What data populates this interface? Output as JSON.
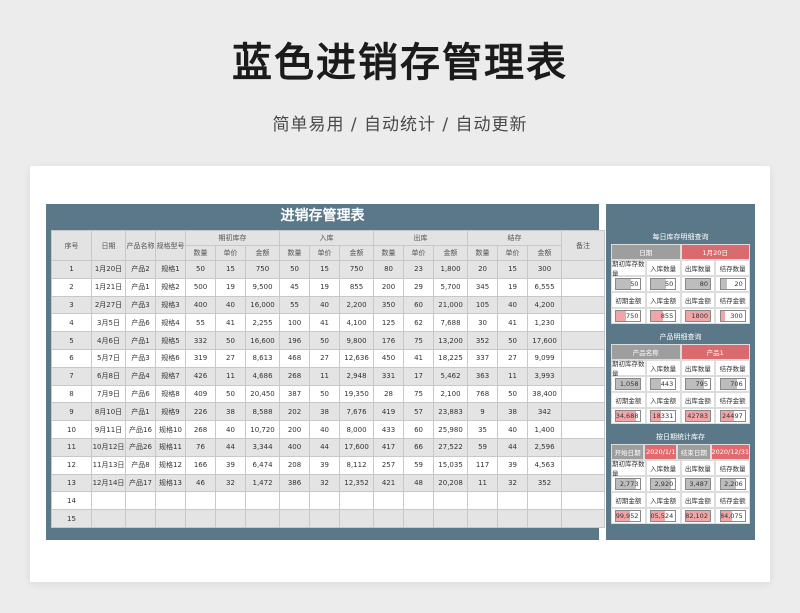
{
  "hero": {
    "title": "蓝色进销存管理表",
    "subtitle": "简单易用 / 自动统计 / 自动更新"
  },
  "sheet": {
    "title": "进销存管理表",
    "header_groups": {
      "seq": "序号",
      "date": "日期",
      "product": "产品名称",
      "spec": "规格型号",
      "opening": "期初库存",
      "inbound": "入库",
      "outbound": "出库",
      "closing": "结存",
      "remark": "备注"
    },
    "sub_headers": {
      "qty": "数量",
      "price": "单价",
      "amount": "金额"
    },
    "rows": [
      [
        "1",
        "1月20日",
        "产品2",
        "规格1",
        "50",
        "15",
        "750",
        "50",
        "15",
        "750",
        "80",
        "23",
        "1,800",
        "20",
        "15",
        "300",
        ""
      ],
      [
        "2",
        "1月21日",
        "产品1",
        "规格2",
        "500",
        "19",
        "9,500",
        "45",
        "19",
        "855",
        "200",
        "29",
        "5,700",
        "345",
        "19",
        "6,555",
        ""
      ],
      [
        "3",
        "2月27日",
        "产品3",
        "规格3",
        "400",
        "40",
        "16,000",
        "55",
        "40",
        "2,200",
        "350",
        "60",
        "21,000",
        "105",
        "40",
        "4,200",
        ""
      ],
      [
        "4",
        "3月5日",
        "产品6",
        "规格4",
        "55",
        "41",
        "2,255",
        "100",
        "41",
        "4,100",
        "125",
        "62",
        "7,688",
        "30",
        "41",
        "1,230",
        ""
      ],
      [
        "5",
        "4月6日",
        "产品1",
        "规格5",
        "332",
        "50",
        "16,600",
        "196",
        "50",
        "9,800",
        "176",
        "75",
        "13,200",
        "352",
        "50",
        "17,600",
        ""
      ],
      [
        "6",
        "5月7日",
        "产品3",
        "规格6",
        "319",
        "27",
        "8,613",
        "468",
        "27",
        "12,636",
        "450",
        "41",
        "18,225",
        "337",
        "27",
        "9,099",
        ""
      ],
      [
        "7",
        "6月8日",
        "产品4",
        "规格7",
        "426",
        "11",
        "4,686",
        "268",
        "11",
        "2,948",
        "331",
        "17",
        "5,462",
        "363",
        "11",
        "3,993",
        ""
      ],
      [
        "8",
        "7月9日",
        "产品6",
        "规格8",
        "409",
        "50",
        "20,450",
        "387",
        "50",
        "19,350",
        "28",
        "75",
        "2,100",
        "768",
        "50",
        "38,400",
        ""
      ],
      [
        "9",
        "8月10日",
        "产品1",
        "规格9",
        "226",
        "38",
        "8,588",
        "202",
        "38",
        "7,676",
        "419",
        "57",
        "23,883",
        "9",
        "38",
        "342",
        ""
      ],
      [
        "10",
        "9月11日",
        "产品16",
        "规格10",
        "268",
        "40",
        "10,720",
        "200",
        "40",
        "8,000",
        "433",
        "60",
        "25,980",
        "35",
        "40",
        "1,400",
        ""
      ],
      [
        "11",
        "10月12日",
        "产品26",
        "规格11",
        "76",
        "44",
        "3,344",
        "400",
        "44",
        "17,600",
        "417",
        "66",
        "27,522",
        "59",
        "44",
        "2,596",
        ""
      ],
      [
        "12",
        "11月13日",
        "产品8",
        "规格12",
        "166",
        "39",
        "6,474",
        "208",
        "39",
        "8,112",
        "257",
        "59",
        "15,035",
        "117",
        "39",
        "4,563",
        ""
      ],
      [
        "13",
        "12月14日",
        "产品17",
        "规格13",
        "46",
        "32",
        "1,472",
        "386",
        "32",
        "12,352",
        "421",
        "48",
        "20,208",
        "11",
        "32",
        "352",
        ""
      ],
      [
        "14",
        "",
        "",
        "",
        "",
        "",
        "",
        "",
        "",
        "",
        "",
        "",
        "",
        "",
        "",
        "",
        ""
      ],
      [
        "15",
        "",
        "",
        "",
        "",
        "",
        "",
        "",
        "",
        "",
        "",
        "",
        "",
        "",
        "",
        "",
        ""
      ]
    ]
  },
  "daily": {
    "title": "每日库存明细查询",
    "date_label": "日期",
    "date_value": "1月20日",
    "labels1": [
      "期初库存数量",
      "入库数量",
      "出库数量",
      "结存数量"
    ],
    "values1": [
      "50",
      "50",
      "80",
      "20"
    ],
    "labels2": [
      "初期金额",
      "入库金额",
      "出库金额",
      "结存金额"
    ],
    "values2": [
      "750",
      "855",
      "1800",
      "300"
    ]
  },
  "product": {
    "title": "产品明细查询",
    "name_label": "产品名称",
    "name_value": "产品1",
    "labels1": [
      "期初库存数量",
      "入库数量",
      "出库数量",
      "结存数量"
    ],
    "values1": [
      "1,058",
      "443",
      "795",
      "706"
    ],
    "labels2": [
      "初期金额",
      "入库金额",
      "出库金额",
      "结存金额"
    ],
    "values2": [
      "34,688",
      "18331",
      "42783",
      "24497"
    ]
  },
  "range": {
    "title": "按日期统计库存",
    "start_label": "开始日期",
    "start_value": "2020/1/1",
    "end_label": "结束日期",
    "end_value": "2020/12/31",
    "labels1": [
      "期初库存数量",
      "入库数量",
      "出库数量",
      "结存数量"
    ],
    "values1": [
      "2,773",
      "2,920",
      "3,487",
      "2,206"
    ],
    "labels2": [
      "初期金额",
      "入库金额",
      "出库金额",
      "结存金额"
    ],
    "values2": [
      "99,952",
      "105,524",
      "182,102",
      "84,075"
    ]
  },
  "colors": {
    "frame": "#5b7888",
    "accent_red": "#d96b6f",
    "band": "#e4e4e4"
  }
}
